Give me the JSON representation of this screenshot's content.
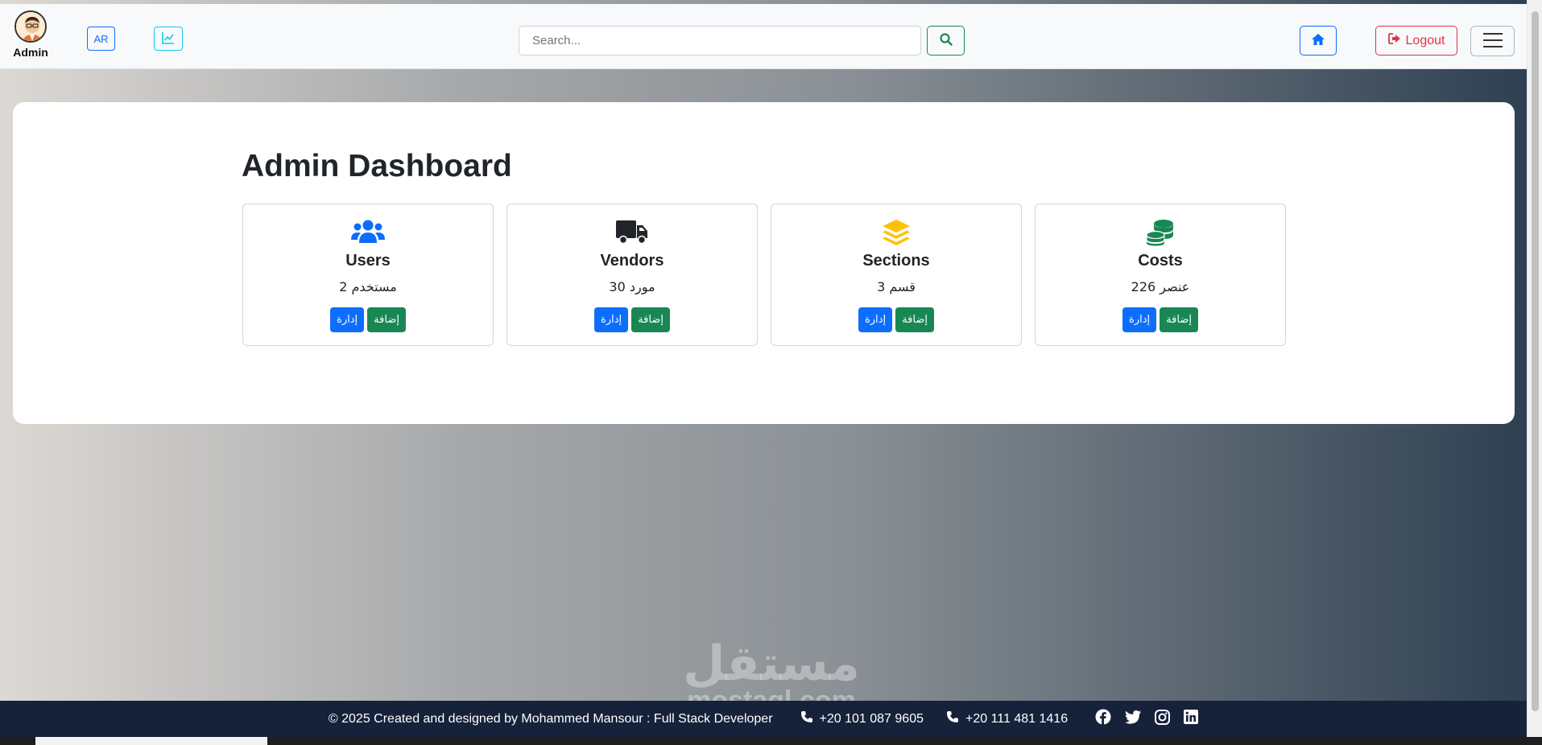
{
  "topbar": {
    "user_name": "Admin",
    "lang_button": "AR",
    "search_placeholder": "Search...",
    "logout_label": "Logout"
  },
  "dashboard": {
    "title": "Admin Dashboard",
    "cards": [
      {
        "title": "Users",
        "count": "مستخدم 2",
        "manage": "إدارة",
        "add": "إضافة",
        "color": "#0d6efd",
        "icon": "users-icon"
      },
      {
        "title": "Vendors",
        "count": "مورد 30",
        "manage": "إدارة",
        "add": "إضافة",
        "color": "#212529",
        "icon": "truck-icon"
      },
      {
        "title": "Sections",
        "count": "قسم 3",
        "manage": "إدارة",
        "add": "إضافة",
        "color": "#ffc107",
        "icon": "layers-icon"
      },
      {
        "title": "Costs",
        "count": "عنصر 226",
        "manage": "إدارة",
        "add": "إضافة",
        "color": "#198754",
        "icon": "coins-icon"
      }
    ]
  },
  "watermark": {
    "arabic": "مستقل",
    "latin": "mostaql.com"
  },
  "footer": {
    "credit": "© 2025 Created and designed by Mohammed Mansour : Full Stack Developer",
    "phone1": "+20 101 087 9605",
    "phone2": "+20 111 481 1416",
    "social": [
      "facebook-icon",
      "twitter-icon",
      "instagram-icon",
      "linkedin-icon"
    ]
  },
  "colors": {
    "primary": "#0d6efd",
    "success": "#198754",
    "danger": "#dc3545",
    "info": "#0dcaf0",
    "footer_bg": "#16213a"
  }
}
